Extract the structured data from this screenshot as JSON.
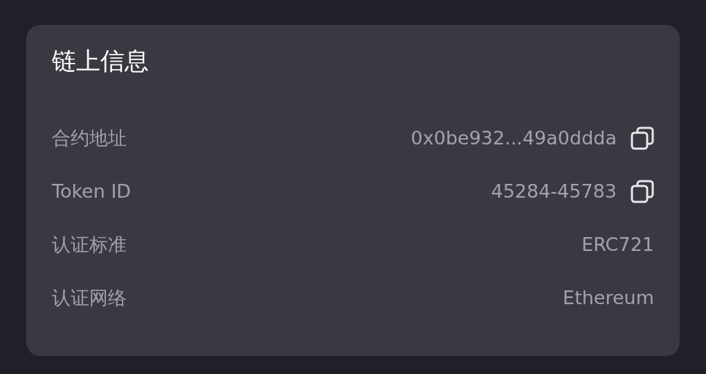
{
  "card": {
    "title": "链上信息",
    "rows": [
      {
        "label": "合约地址",
        "value": "0x0be932...49a0ddda",
        "copyable": true
      },
      {
        "label": "Token ID",
        "value": "45284-45783",
        "copyable": true
      },
      {
        "label": "认证标准",
        "value": "ERC721",
        "copyable": false
      },
      {
        "label": "认证网络",
        "value": "Ethereum",
        "copyable": false
      }
    ]
  }
}
